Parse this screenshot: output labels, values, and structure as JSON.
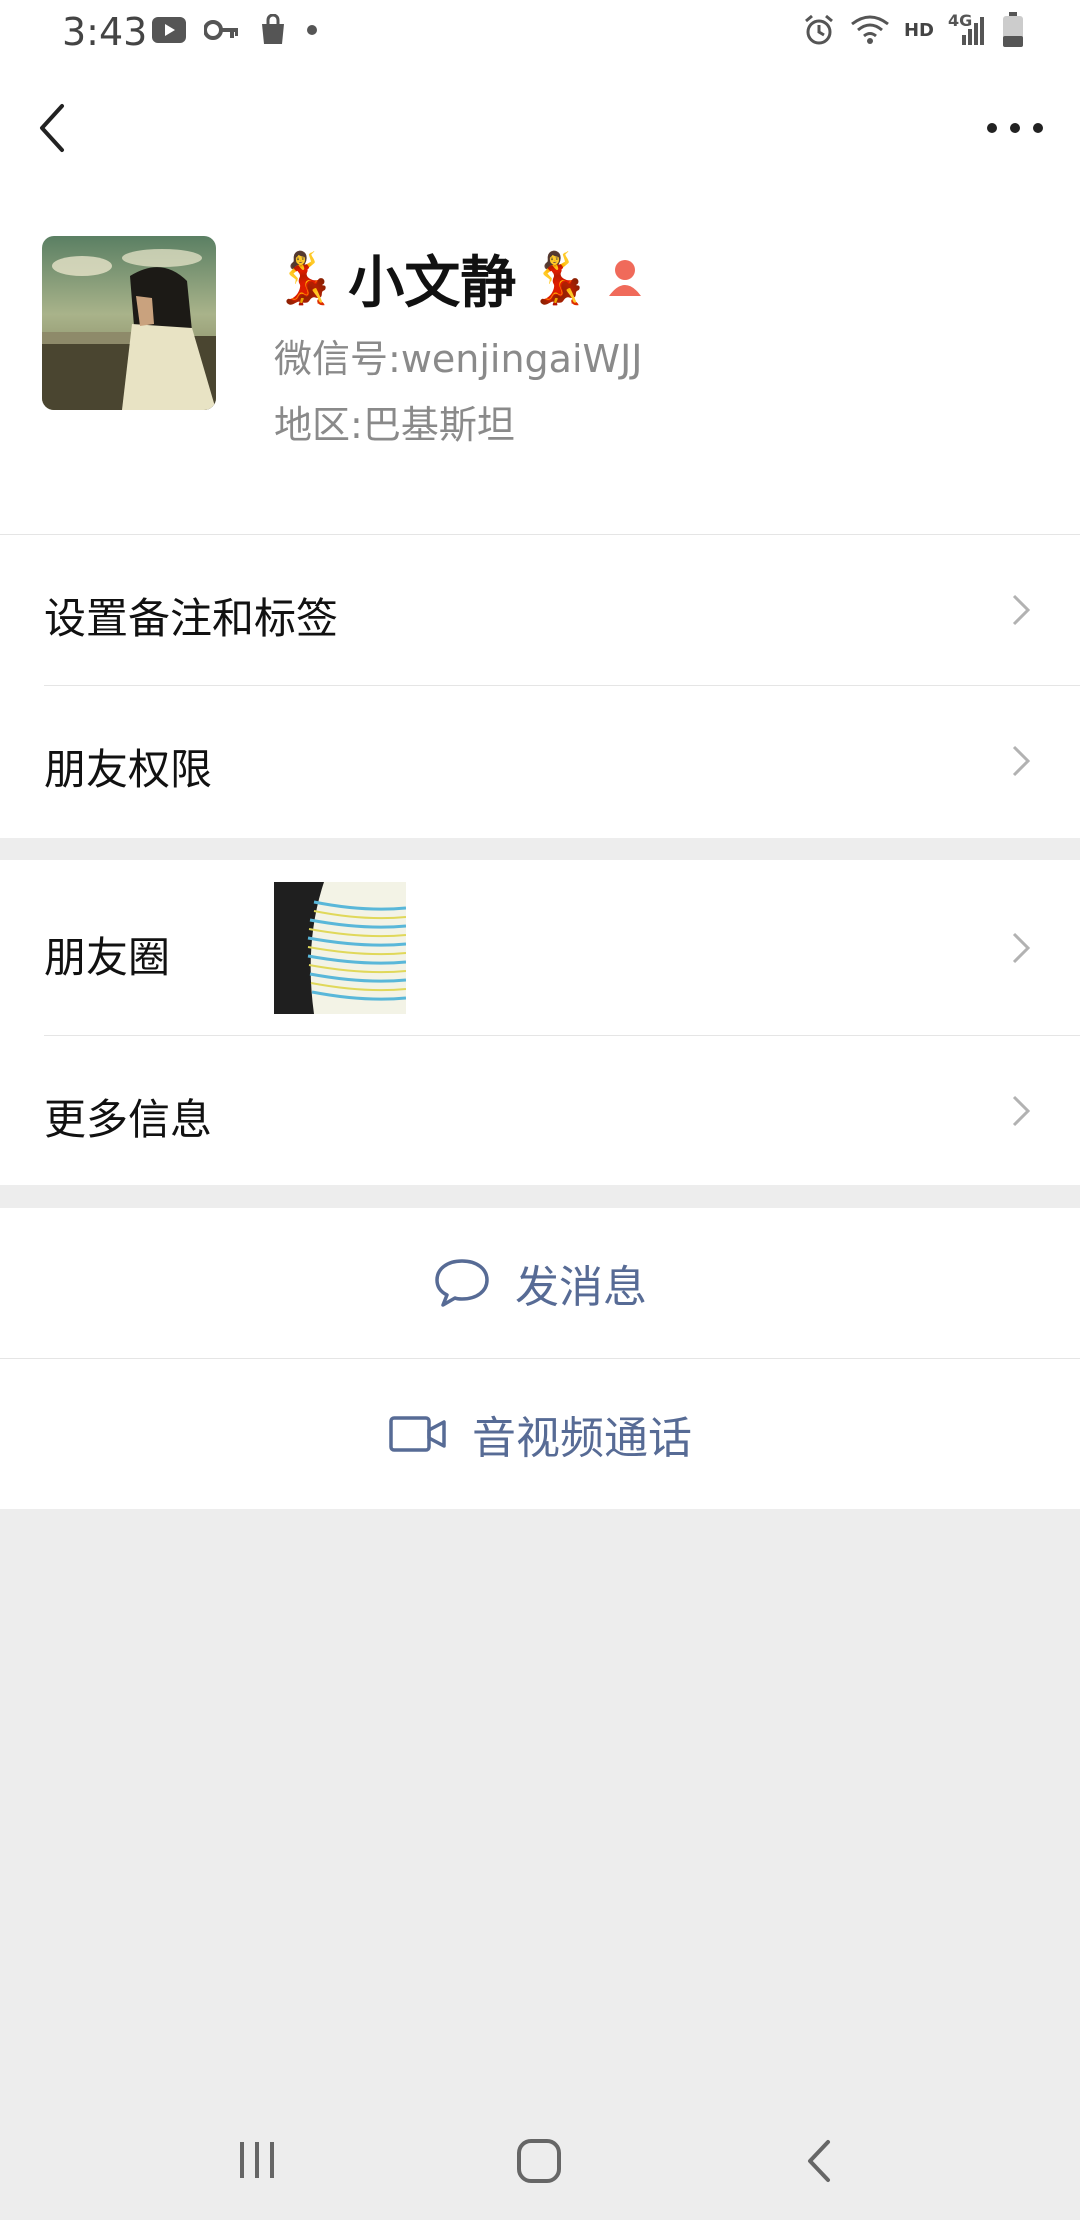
{
  "status_bar": {
    "time": "3:43",
    "left_icons": [
      "youtube-icon",
      "key-icon",
      "shopping-bag-icon",
      "dot-icon"
    ],
    "right_icons": [
      "alarm-icon",
      "wifi-icon",
      "hd-label",
      "4g-signal-icon",
      "battery-icon"
    ],
    "hd_text": "HD",
    "network_text": "4G"
  },
  "nav": {
    "back_icon": "chevron-left-icon",
    "more_icon": "more-dots-icon"
  },
  "profile": {
    "name": "小文静",
    "name_decoration": "💃",
    "gender_icon": "female-icon",
    "wechat_id_label": "微信号:",
    "wechat_id": "wenjingaiWJJ",
    "region_label": "地区:",
    "region": "巴基斯坦"
  },
  "menu": {
    "remarks_tags": "设置备注和标签",
    "friend_permissions": "朋友权限",
    "moments": "朋友圈",
    "more_info": "更多信息"
  },
  "actions": {
    "send_message": "发消息",
    "video_call": "音视频通话"
  },
  "colors": {
    "link_blue": "#576b95",
    "background": "#ededed",
    "gender_female": "#f06a5a"
  }
}
